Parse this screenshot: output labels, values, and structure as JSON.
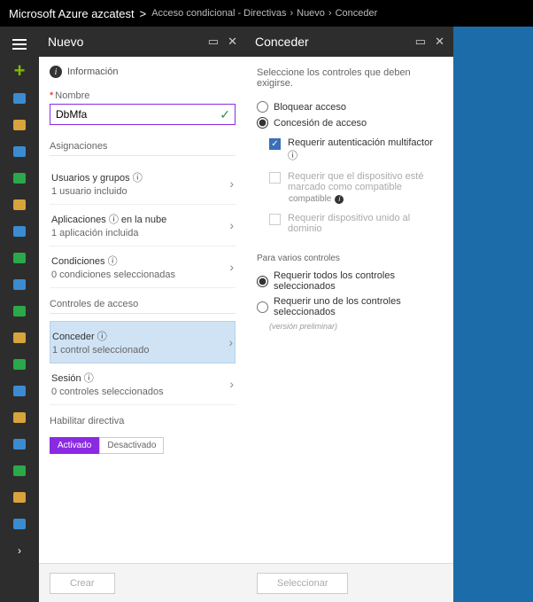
{
  "header": {
    "brand_prefix": "Microsoft ",
    "brand_bold": "Azure",
    "tenant": " azcatest",
    "gt": ">",
    "breadcrumbs": [
      "Acceso condicional - Directivas",
      "Nuevo",
      "Conceder"
    ]
  },
  "rail": {
    "plus": "+",
    "icons": [
      {
        "name": "dashboard-icon",
        "color": "#3b8bd1"
      },
      {
        "name": "grid-icon",
        "color": "#d8a33a"
      },
      {
        "name": "cube-icon",
        "color": "#3b8bd1"
      },
      {
        "name": "globe-icon",
        "color": "#2aa84a"
      },
      {
        "name": "bolt-icon",
        "color": "#d8a33a"
      },
      {
        "name": "db-icon",
        "color": "#3b8bd1"
      },
      {
        "name": "drop-icon",
        "color": "#2aa84a"
      },
      {
        "name": "monitor-icon",
        "color": "#3b8bd1"
      },
      {
        "name": "diamond-icon",
        "color": "#2aa84a"
      },
      {
        "name": "card-icon",
        "color": "#d8a33a"
      },
      {
        "name": "net-icon",
        "color": "#2aa84a"
      },
      {
        "name": "shield1-icon",
        "color": "#3b8bd1"
      },
      {
        "name": "gauge-icon",
        "color": "#d8a33a"
      },
      {
        "name": "cloud-icon",
        "color": "#3b8bd1"
      },
      {
        "name": "shield2-icon",
        "color": "#2aa84a"
      },
      {
        "name": "ring-icon",
        "color": "#d8a33a"
      },
      {
        "name": "person-icon",
        "color": "#3b8bd1"
      }
    ],
    "chev": "›"
  },
  "blade1": {
    "title": "Nuevo",
    "info": "Información",
    "name_label": "Nombre",
    "name_value": "DbMfa",
    "asign_header": "Asignaciones",
    "rows_asign": [
      {
        "t1": "Usuarios y grupos ⓘ",
        "t2": "1 usuario incluido"
      },
      {
        "t1": "Aplicaciones ⓘ en la nube",
        "t2": "1 aplicación incluida"
      },
      {
        "t1": "Condiciones ⓘ",
        "t2": "0 condiciones seleccionadas"
      }
    ],
    "access_header": "Controles de acceso",
    "rows_access": [
      {
        "t1": "Conceder ⓘ",
        "t2": "1 control seleccionado",
        "sel": true
      },
      {
        "t1": "Sesión ⓘ",
        "t2": "0 controles seleccionados",
        "sel": false
      }
    ],
    "enable_header": "Habilitar directiva",
    "toggle_on": "Activado",
    "toggle_off": "Desactivado",
    "footer_btn": "Crear"
  },
  "blade2": {
    "title": "Conceder",
    "intro": "Seleccione los controles que deben exigirse.",
    "radio_block": "Bloquear acceso",
    "radio_grant": "Concesión de acceso",
    "cb_mfa": "Requerir autenticación multifactor ⓘ",
    "cb_device": "Requerir que el dispositivo esté marcado como compatible",
    "cb_domain": "Requerir dispositivo unido al dominio",
    "multi_header": "Para varios controles",
    "radio_all": "Requerir todos los controles seleccionados",
    "radio_one": "Requerir uno de los controles seleccionados",
    "preview": "(versión preliminar)",
    "footer_btn": "Seleccionar"
  }
}
